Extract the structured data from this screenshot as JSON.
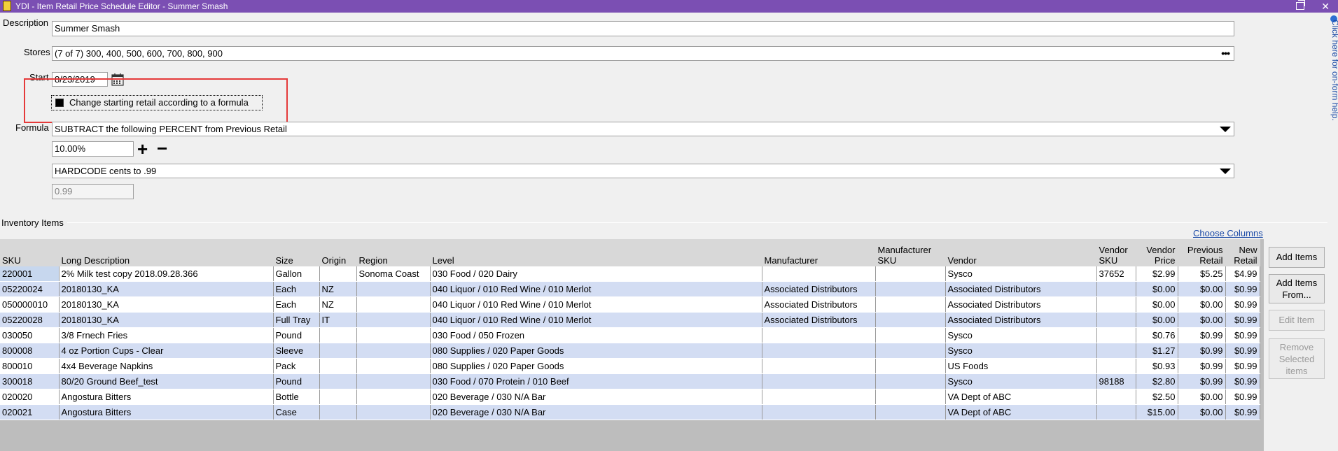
{
  "window": {
    "title": "YDI - Item Retail Price Schedule Editor - Summer Smash",
    "close_glyph": "✕"
  },
  "form": {
    "description_label": "Description",
    "description_value": "Summer Smash",
    "stores_label": "Stores",
    "stores_value": "(7 of 7) 300, 400, 500, 600, 700, 800, 900",
    "stores_more": "•••",
    "start_label": "Start",
    "start_value": "8/23/2019",
    "formula_checkbox_label": "Change starting retail according to a formula",
    "formula_checkbox_checked": true,
    "formula_label": "Formula",
    "formula_value": "SUBTRACT the following PERCENT from Previous Retail",
    "percent_value": "10.00%",
    "plus_glyph": "+",
    "minus_glyph": "−",
    "rounding_value": "HARDCODE cents to .99",
    "cents_value": "0.99"
  },
  "inventory": {
    "section_label": "Inventory Items",
    "choose_columns": "Choose Columns",
    "columns": {
      "sku": "SKU",
      "long_description": "Long Description",
      "size": "Size",
      "origin": "Origin",
      "region": "Region",
      "level": "Level",
      "manufacturer": "Manufacturer",
      "manufacturer_sku": "Manufacturer SKU",
      "vendor": "Vendor",
      "vendor_sku": "Vendor SKU",
      "vendor_price": "Vendor Price",
      "previous_retail": "Previous Retail",
      "new_retail": "New Retail"
    },
    "rows": [
      {
        "sku": "220001",
        "desc": "2% Milk test copy 2018.09.28.366",
        "size": "Gallon",
        "origin": "",
        "region": "Sonoma Coast",
        "level": "030 Food / 020 Dairy",
        "mfr": "",
        "mfr_sku": "",
        "vendor": "Sysco",
        "vendor_sku": "37652",
        "vendor_price": "$2.99",
        "prev": "$5.25",
        "new": "$4.99"
      },
      {
        "sku": "05220024",
        "desc": "20180130_KA",
        "size": "Each",
        "origin": "NZ",
        "region": "",
        "level": "040 Liquor / 010 Red Wine / 010 Merlot",
        "mfr": "Associated Distributors",
        "mfr_sku": "",
        "vendor": "Associated Distributors",
        "vendor_sku": "",
        "vendor_price": "$0.00",
        "prev": "$0.00",
        "new": "$0.99"
      },
      {
        "sku": "050000010",
        "desc": "20180130_KA",
        "size": "Each",
        "origin": "NZ",
        "region": "",
        "level": "040 Liquor / 010 Red Wine / 010 Merlot",
        "mfr": "Associated Distributors",
        "mfr_sku": "",
        "vendor": "Associated Distributors",
        "vendor_sku": "",
        "vendor_price": "$0.00",
        "prev": "$0.00",
        "new": "$0.99"
      },
      {
        "sku": "05220028",
        "desc": "20180130_KA",
        "size": "Full Tray",
        "origin": "IT",
        "region": "",
        "level": "040 Liquor / 010 Red Wine / 010 Merlot",
        "mfr": "Associated Distributors",
        "mfr_sku": "",
        "vendor": "Associated Distributors",
        "vendor_sku": "",
        "vendor_price": "$0.00",
        "prev": "$0.00",
        "new": "$0.99"
      },
      {
        "sku": "030050",
        "desc": "3/8 Frnech Fries",
        "size": "Pound",
        "origin": "",
        "region": "",
        "level": "030 Food / 050 Frozen",
        "mfr": "",
        "mfr_sku": "",
        "vendor": "Sysco",
        "vendor_sku": "",
        "vendor_price": "$0.76",
        "prev": "$0.99",
        "new": "$0.99"
      },
      {
        "sku": "800008",
        "desc": "4 oz Portion Cups - Clear",
        "size": "Sleeve",
        "origin": "",
        "region": "",
        "level": "080 Supplies / 020 Paper Goods",
        "mfr": "",
        "mfr_sku": "",
        "vendor": "Sysco",
        "vendor_sku": "",
        "vendor_price": "$1.27",
        "prev": "$0.99",
        "new": "$0.99"
      },
      {
        "sku": "800010",
        "desc": "4x4 Beverage Napkins",
        "size": "Pack",
        "origin": "",
        "region": "",
        "level": "080 Supplies / 020 Paper Goods",
        "mfr": "",
        "mfr_sku": "",
        "vendor": "US Foods",
        "vendor_sku": "",
        "vendor_price": "$0.93",
        "prev": "$0.99",
        "new": "$0.99"
      },
      {
        "sku": "300018",
        "desc": "80/20 Ground Beef_test",
        "size": "Pound",
        "origin": "",
        "region": "",
        "level": "030 Food / 070 Protein / 010 Beef",
        "mfr": "",
        "mfr_sku": "",
        "vendor": "Sysco",
        "vendor_sku": "98188",
        "vendor_price": "$2.80",
        "prev": "$0.99",
        "new": "$0.99"
      },
      {
        "sku": "020020",
        "desc": "Angostura Bitters",
        "size": "Bottle",
        "origin": "",
        "region": "",
        "level": "020 Beverage / 030 N/A Bar",
        "mfr": "",
        "mfr_sku": "",
        "vendor": "VA Dept of ABC",
        "vendor_sku": "",
        "vendor_price": "$2.50",
        "prev": "$0.00",
        "new": "$0.99"
      },
      {
        "sku": "020021",
        "desc": "Angostura Bitters",
        "size": "Case",
        "origin": "",
        "region": "",
        "level": "020 Beverage / 030 N/A Bar",
        "mfr": "",
        "mfr_sku": "",
        "vendor": "VA Dept of ABC",
        "vendor_sku": "",
        "vendor_price": "$15.00",
        "prev": "$0.00",
        "new": "$0.99"
      }
    ]
  },
  "side_buttons": {
    "add_items": "Add Items",
    "add_items_from": "Add Items From...",
    "edit_item": "Edit Item",
    "remove_selected": "Remove Selected items"
  },
  "help": {
    "text": "Click here for on-form help."
  },
  "colors": {
    "titlebar": "#7b4fb3",
    "highlight_box": "#e53a3a",
    "row_alt": "#d3ddf3",
    "link": "#1b4aa6"
  }
}
